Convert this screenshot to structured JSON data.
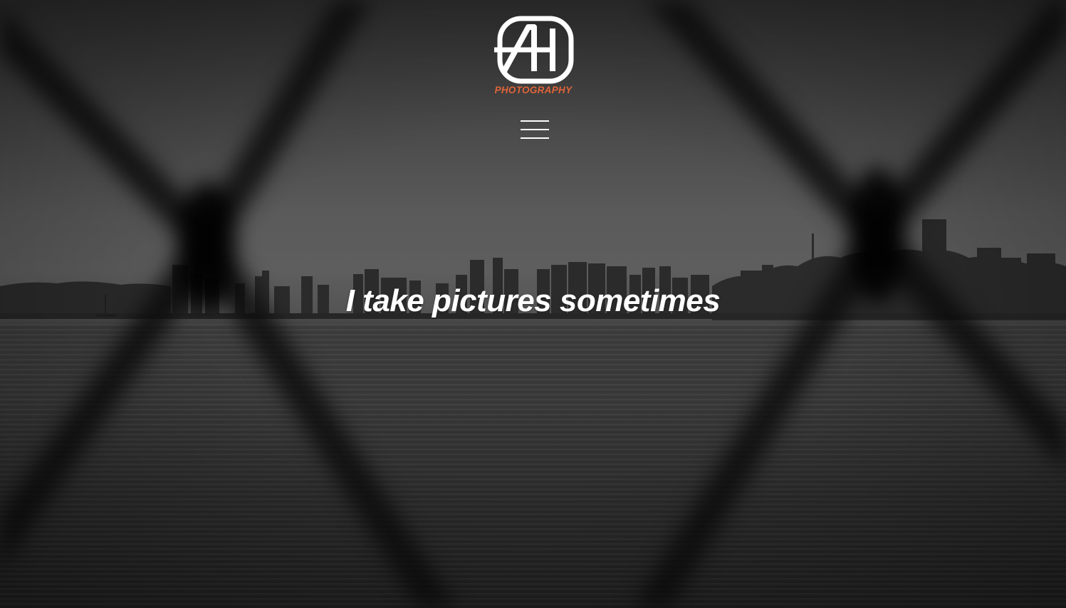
{
  "brand": {
    "logo_letters": "AH",
    "logo_subtitle": "PHOTOGRAPHY",
    "accent_color": "#e0653a"
  },
  "nav": {
    "menu_icon": "hamburger-menu-icon"
  },
  "hero": {
    "tagline": "I take pictures sometimes",
    "background": "grayscale city skyline over water seen through blurred chain-link fence"
  }
}
